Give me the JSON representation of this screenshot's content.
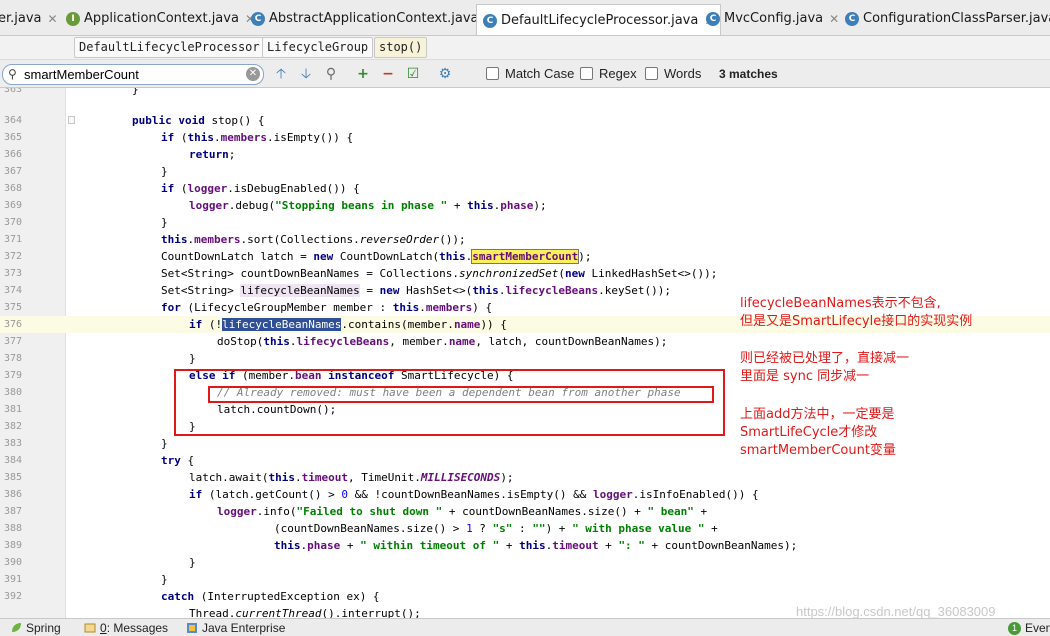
{
  "tabs": [
    {
      "label": "er.java",
      "icon": "java-class-icon",
      "active": false
    },
    {
      "label": "ApplicationContext.java",
      "icon": "interface-icon",
      "active": false
    },
    {
      "label": "AbstractApplicationContext.java",
      "icon": "class-icon",
      "active": false
    },
    {
      "label": "DefaultLifecycleProcessor.java",
      "icon": "class-icon",
      "active": true
    },
    {
      "label": "MvcConfig.java",
      "icon": "class-icon",
      "active": false
    },
    {
      "label": "ConfigurationClassParser.java",
      "icon": "class-icon",
      "active": false
    }
  ],
  "breadcrumb": [
    "DefaultLifecycleProcessor",
    "LifecycleGroup",
    "stop()"
  ],
  "search": {
    "value": "smartMemberCount",
    "match_case": "Match Case",
    "regex": "Regex",
    "words": "Words",
    "matches": "3 matches"
  },
  "code": {
    "line_numbers": [
      "363",
      "364",
      "365",
      "366",
      "367",
      "368",
      "369",
      "370",
      "371",
      "372",
      "373",
      "374",
      "375",
      "376",
      "377",
      "378",
      "379",
      "380",
      "381",
      "382",
      "383",
      "384",
      "385",
      "386",
      "387",
      "388",
      "389",
      "390",
      "391",
      "392"
    ],
    "highlighted_line": "376"
  },
  "annotations": {
    "note1_line1": "lifecycleBeanNames表示不包含,",
    "note1_line2": "但是又是SmartLifecyle接口的实现实例",
    "note2_line1": "则已经被已处理了，直接减一",
    "note2_line2": "里面是 sync 同步减一",
    "note3_line1": "上面add方法中，一定要是",
    "note3_line2": "SmartLifeCycle才修改",
    "note3_line3": "smartMemberCount变量"
  },
  "status_bar": {
    "spring": "Spring",
    "messages_key": "0",
    "messages": ": Messages",
    "java_enterprise": "Java Enterprise",
    "event_count": "1",
    "event": "Even"
  },
  "watermark": "https://blog.csdn.net/qq_36083009",
  "colors": {
    "annotation": "#e01818",
    "keyword": "#000080",
    "field": "#660e7a",
    "string": "#008000",
    "search_mark": "#fbef5e",
    "selection": "#2f4f96"
  }
}
